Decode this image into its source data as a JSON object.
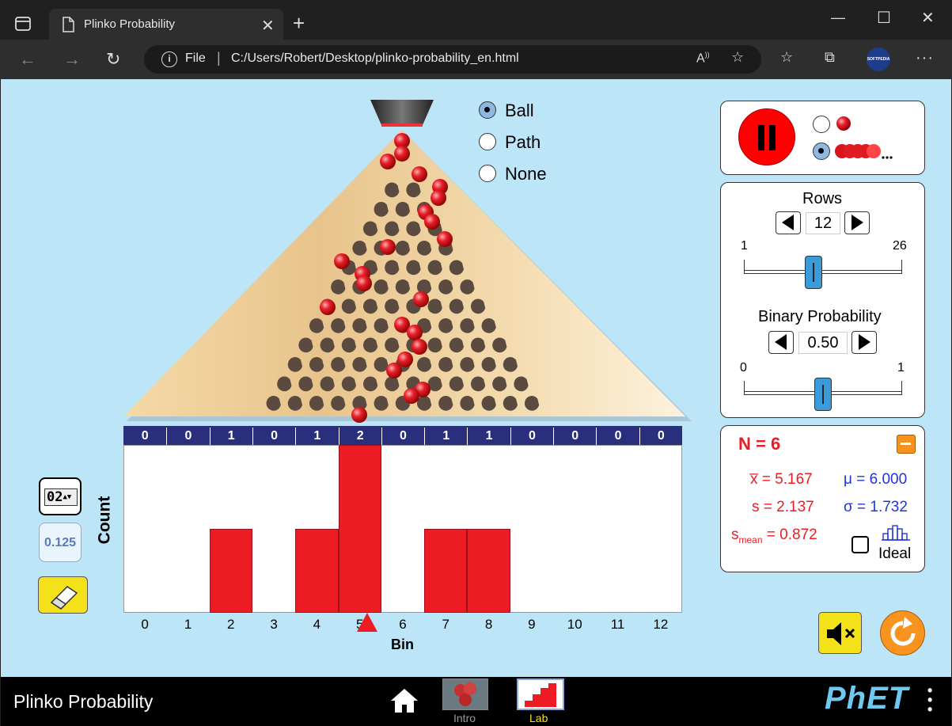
{
  "browser": {
    "tab_title": "Plinko Probability",
    "address_prefix": "File",
    "address_url": "C:/Users/Robert/Desktop/plinko-probability_en.html",
    "profile_label": "SOFTPEDIA"
  },
  "sim": {
    "display_options": [
      "Ball",
      "Path",
      "None"
    ],
    "selected_display": "Ball",
    "rows_label": "Rows",
    "rows_value": "12",
    "rows_min": "1",
    "rows_max": "26",
    "rows_fraction": 0.44,
    "prob_label": "Binary Probability",
    "prob_value": "0.50",
    "prob_min": "0",
    "prob_max": "1",
    "prob_fraction": 0.5,
    "bins": [
      "0",
      "1",
      "2",
      "3",
      "4",
      "5",
      "6",
      "7",
      "8",
      "9",
      "10",
      "11",
      "12"
    ],
    "counts": [
      0,
      0,
      1,
      0,
      1,
      2,
      0,
      1,
      1,
      0,
      0,
      0,
      0
    ],
    "ylabel": "Count",
    "xlabel": "Bin",
    "counter_icon_text": "02",
    "fraction_button": "0.125",
    "stats": {
      "n": "N = 6",
      "xbar": "x̅ = 5.167",
      "mu": "μ = 6.000",
      "s": "s = 2.137",
      "sigma": "σ = 1.732",
      "smean_base": "s",
      "smean_sub": "mean",
      "smean_val": " = 0.872",
      "ideal": "Ideal"
    }
  },
  "footer": {
    "title": "Plinko Probability",
    "tab_intro": "Intro",
    "tab_lab": "Lab",
    "logo": "PhET"
  },
  "colors": {
    "app_bg": "#bde5f8",
    "bar": "#ed1c24",
    "bin_header": "#2a2f7d",
    "accent_orange": "#f7931e"
  }
}
